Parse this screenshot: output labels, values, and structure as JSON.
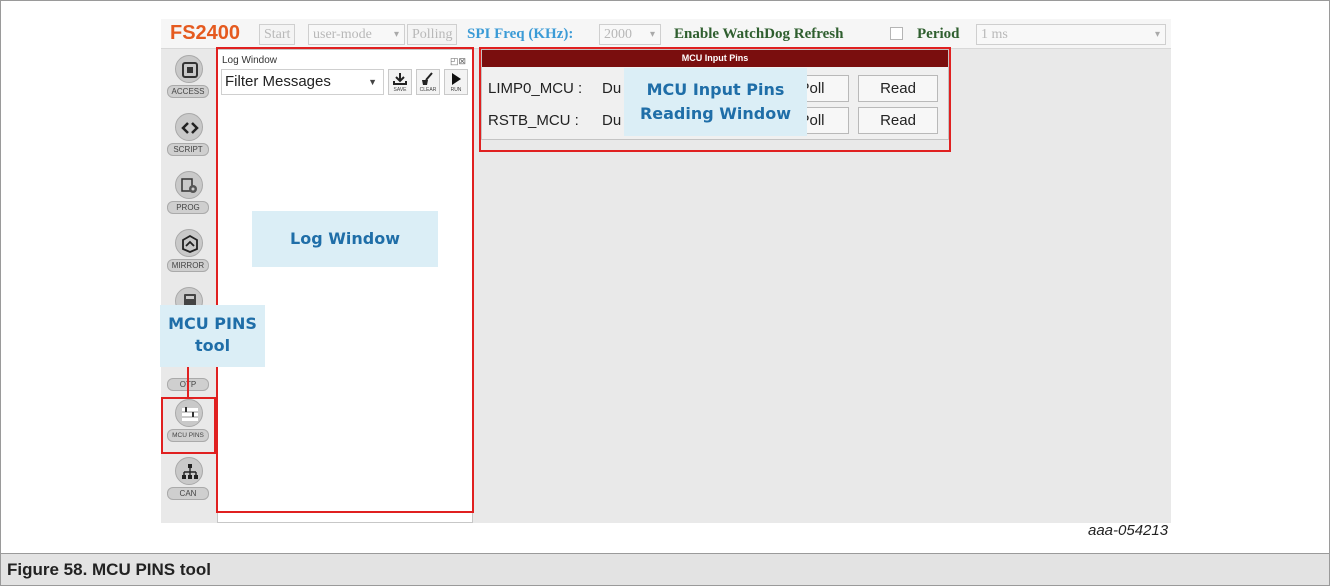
{
  "toolbar": {
    "brand": "FS2400",
    "start_label": "Start",
    "mode_value": "user-mode",
    "polling_label": "Polling",
    "spi_label": "SPI Freq (KHz):",
    "spi_value": "2000",
    "watchdog_label": "Enable WatchDog Refresh",
    "period_label": "Period",
    "period_value": "1 ms"
  },
  "sidebar": {
    "items": [
      {
        "label": "ACCESS",
        "icon": "access-icon"
      },
      {
        "label": "SCRIPT",
        "icon": "script-icon"
      },
      {
        "label": "PROG",
        "icon": "prog-icon"
      },
      {
        "label": "MIRROR",
        "icon": "mirror-icon"
      },
      {
        "label": "OTP",
        "icon": "otp-icon"
      },
      {
        "label": "MCU PINS",
        "icon": "mcu-pins-icon"
      },
      {
        "label": "CAN",
        "icon": "can-icon"
      }
    ]
  },
  "log_window": {
    "title": "Log Window",
    "filter_value": "Filter Messages",
    "tools": [
      {
        "label": "SAVE",
        "icon": "save-icon"
      },
      {
        "label": "CLEAR",
        "icon": "clear-icon"
      },
      {
        "label": "RUN",
        "icon": "run-icon"
      }
    ]
  },
  "mcu_panel": {
    "title": "MCU Input Pins",
    "rows": [
      {
        "pin": "LIMP0_MCU :",
        "duration": "Du",
        "poll": "Poll",
        "read": "Read"
      },
      {
        "pin": "RSTB_MCU :",
        "duration": "Du",
        "poll": "Poll",
        "read": "Read"
      }
    ]
  },
  "callouts": {
    "mcu_input_pins": [
      "MCU Input Pins",
      "Reading Window"
    ],
    "log_window": "Log Window",
    "mcu_pins_tool": [
      "MCU PINS",
      "tool"
    ]
  },
  "figure": {
    "id": "aaa-054213",
    "caption": "Figure 58.  MCU PINS tool"
  },
  "colors": {
    "brand": "#e55a1f",
    "spi_label": "#3b9bd6",
    "watchdog_label": "#2f5f2f",
    "highlight": "#e02020",
    "callout_bg": "#dbeef6",
    "callout_text": "#1f6ea8",
    "panel_header": "#7a0e0e"
  }
}
